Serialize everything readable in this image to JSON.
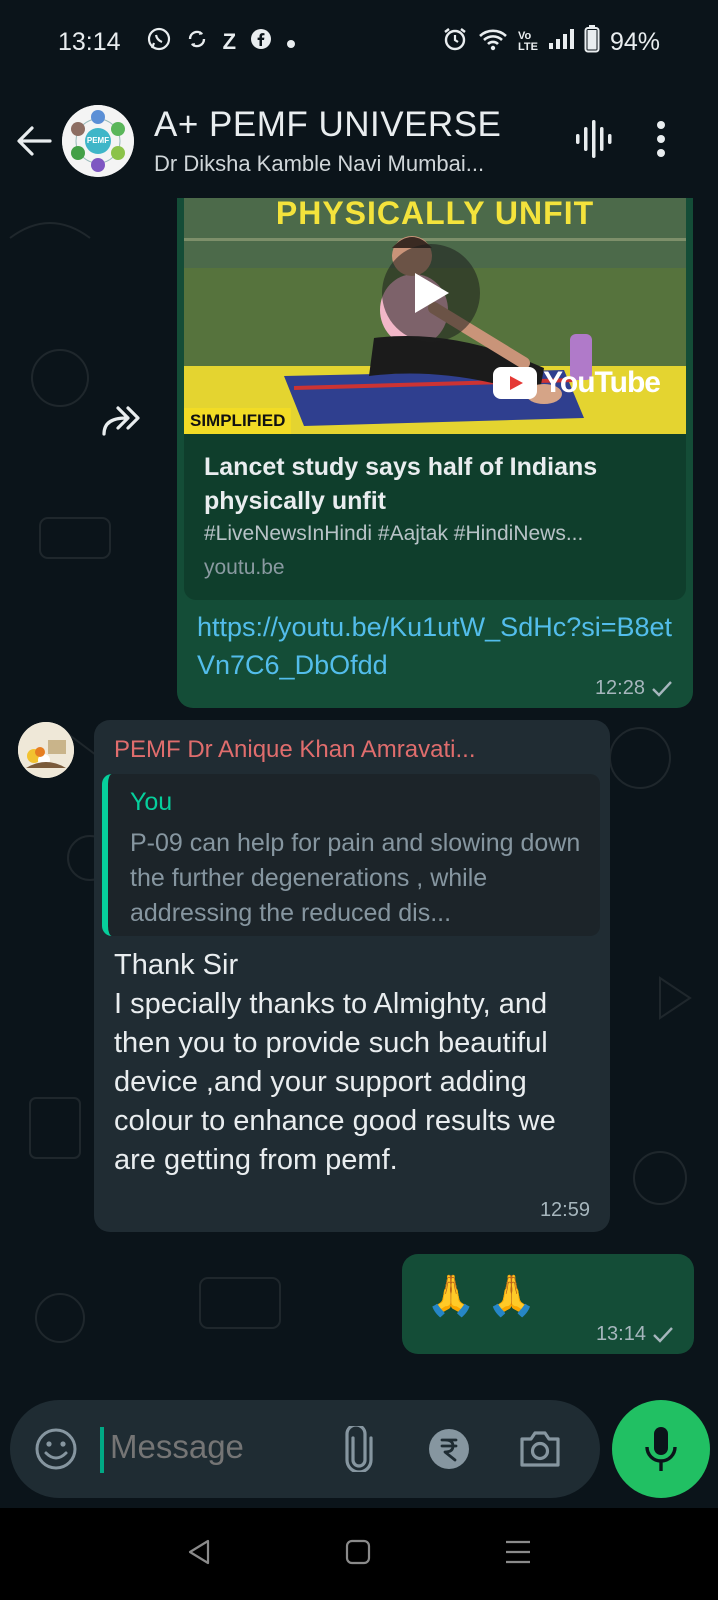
{
  "status_bar": {
    "time": "13:14",
    "battery": "94%",
    "notification_icons": [
      "whatsapp-icon",
      "sync-icon",
      "z-icon",
      "facebook-icon",
      "dot-icon"
    ],
    "system_icons": [
      "alarm-icon",
      "wifi-icon",
      "volte-icon",
      "signal-icon",
      "battery-icon"
    ],
    "volte_label": "Vo\nLTE"
  },
  "header": {
    "title": "A+ PEMF UNIVERSE",
    "subtitle": "Dr Diksha Kamble Navi Mumbai...",
    "avatar_center_label": "PEMF"
  },
  "messages": [
    {
      "type": "outgoing-link",
      "preview": {
        "thumbnail_heading": "PHYSICALLY UNFIT",
        "thumbnail_badge": "SIMPLIFIED",
        "thumbnail_logo": "YouTube",
        "title": "Lancet study says half of Indians physically unfit",
        "description": "#LiveNewsInHindi #Aajtak #HindiNews...",
        "domain": "youtu.be"
      },
      "link": "https://youtu.be/Ku1utW_SdHc?si=B8etVn7C6_DbOfdd",
      "time": "12:28"
    },
    {
      "type": "incoming",
      "sender": "PEMF Dr Anique Khan Amravati...",
      "quote": {
        "author": "You",
        "text": "P-09 can help for pain and slowing down the further degenerations , while addressing the reduced dis..."
      },
      "text": "Thank Sir\nI specially thanks to Almighty, and then you to provide such beautiful device ,and your support adding colour to enhance good results we are getting from pemf.",
      "time": "12:59"
    },
    {
      "type": "outgoing-emoji",
      "text": "🙏 🙏",
      "time": "13:14"
    }
  ],
  "composer": {
    "placeholder": "Message"
  },
  "colors": {
    "background": "#0b141a",
    "outgoing_bubble": "#144d37",
    "incoming_bubble": "#202c33",
    "link": "#53bdeb",
    "sender_name": "#e06d6d",
    "quote_accent": "#06cf9c",
    "mic_button": "#21c063"
  }
}
